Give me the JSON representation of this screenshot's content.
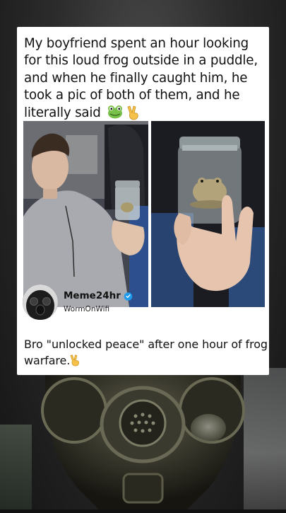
{
  "post": {
    "caption": "My boyfriend spent an hour looking for this loud frog outside in a puddle, and when he finally caught him, he took a pic of both of them, and he literally said",
    "caption_emojis": [
      "frog-face-emoji",
      "victory-hand-emoji"
    ]
  },
  "tweet": {
    "display_name": "Meme24hr",
    "handle": "WormOnWifi",
    "verified": true,
    "verified_color": "#1d9bf0",
    "text": "Bro \"unlocked peace\" after one hour of frog warfare.",
    "text_emoji": "victory-hand-emoji"
  }
}
